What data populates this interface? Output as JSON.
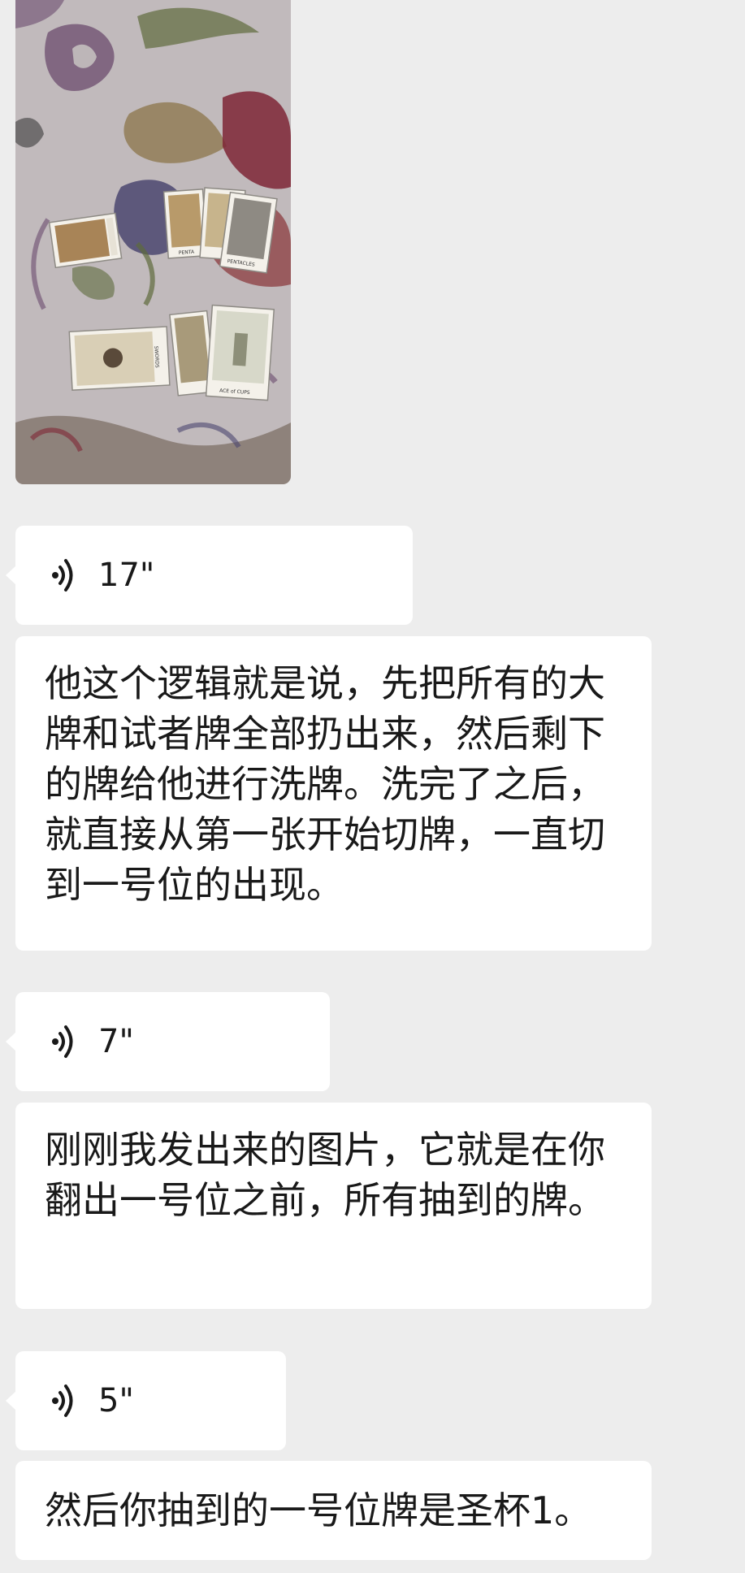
{
  "messages": {
    "photo": {
      "description_icon": "image-message"
    },
    "voice1": {
      "icon": "voice-wave-icon",
      "duration": "17\""
    },
    "text1": {
      "content": "他这个逻辑就是说，先把所有的大牌和试者牌全部扔出来，然后剩下的牌给他进行洗牌。洗完了之后，就直接从第一张开始切牌，一直切到一号位的出现。"
    },
    "voice2": {
      "icon": "voice-wave-icon",
      "duration": "7\""
    },
    "text2": {
      "content": "刚刚我发出来的图片，它就是在你翻出一号位之前，所有抽到的牌。"
    },
    "voice3": {
      "icon": "voice-wave-icon",
      "duration": "5\""
    },
    "text3": {
      "content": "然后你抽到的一号位牌是圣杯1。"
    }
  },
  "photo_card_labels": {
    "pentacles_a": "PENTA",
    "pentacles_b": "PENTACLES",
    "swords": "SWORDS",
    "ace_of_cups": "ACE of CUPS"
  },
  "colors": {
    "background": "#ededed",
    "bubble": "#ffffff",
    "text": "#191919"
  }
}
